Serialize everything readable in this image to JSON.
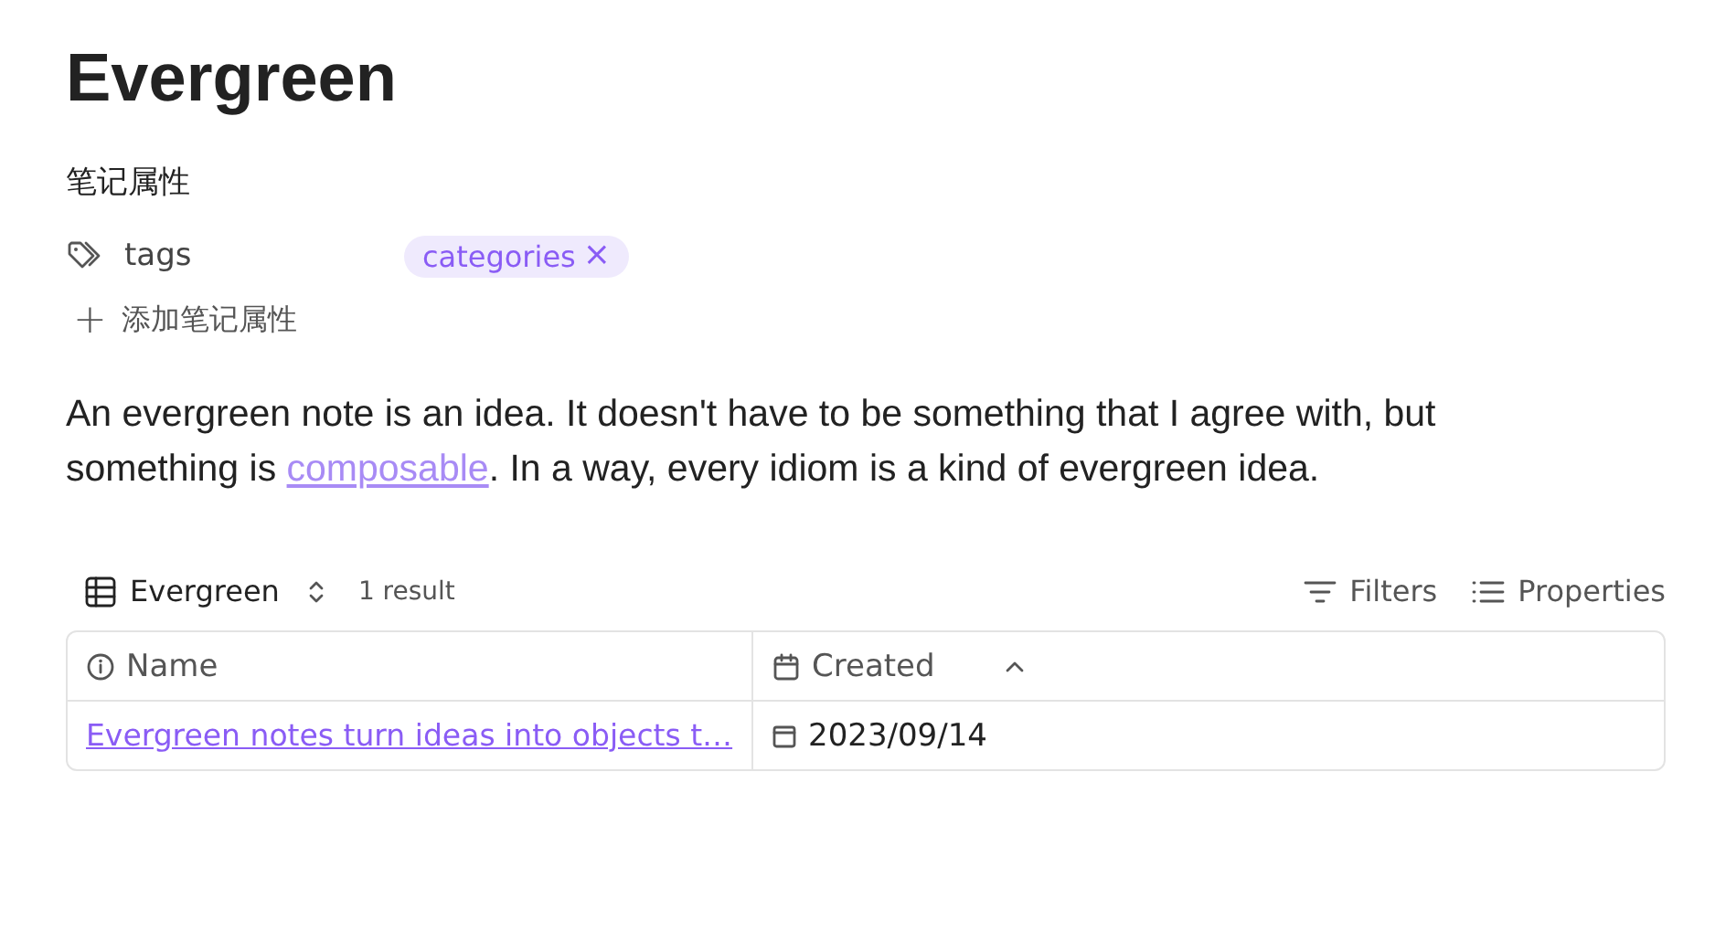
{
  "title": "Evergreen",
  "properties": {
    "heading": "笔记属性",
    "items": [
      {
        "kind": "tags",
        "label": "tags",
        "tags": [
          {
            "label": "categories",
            "remove": "×"
          }
        ]
      }
    ],
    "add": {
      "icon": "+",
      "label": "添加笔记属性"
    }
  },
  "paragraph": {
    "before": "An evergreen note is an idea. It doesn't have to be something that I agree with, but something is ",
    "link": "composable",
    "after": ". In a way, every idiom is a kind of evergreen idea."
  },
  "view": {
    "name": "Evergreen",
    "count": "1 result",
    "actions": [
      {
        "kind": "filter",
        "label": "Filters"
      },
      {
        "kind": "list",
        "label": "Properties"
      }
    ]
  },
  "table": {
    "columns": [
      {
        "kind": "info",
        "label": "Name",
        "sorted": false
      },
      {
        "kind": "date",
        "label": "Created",
        "sorted": true
      }
    ],
    "rows": [
      {
        "cells": [
          "Evergreen notes turn ideas into objects t…",
          "2023/09/14"
        ]
      }
    ]
  }
}
